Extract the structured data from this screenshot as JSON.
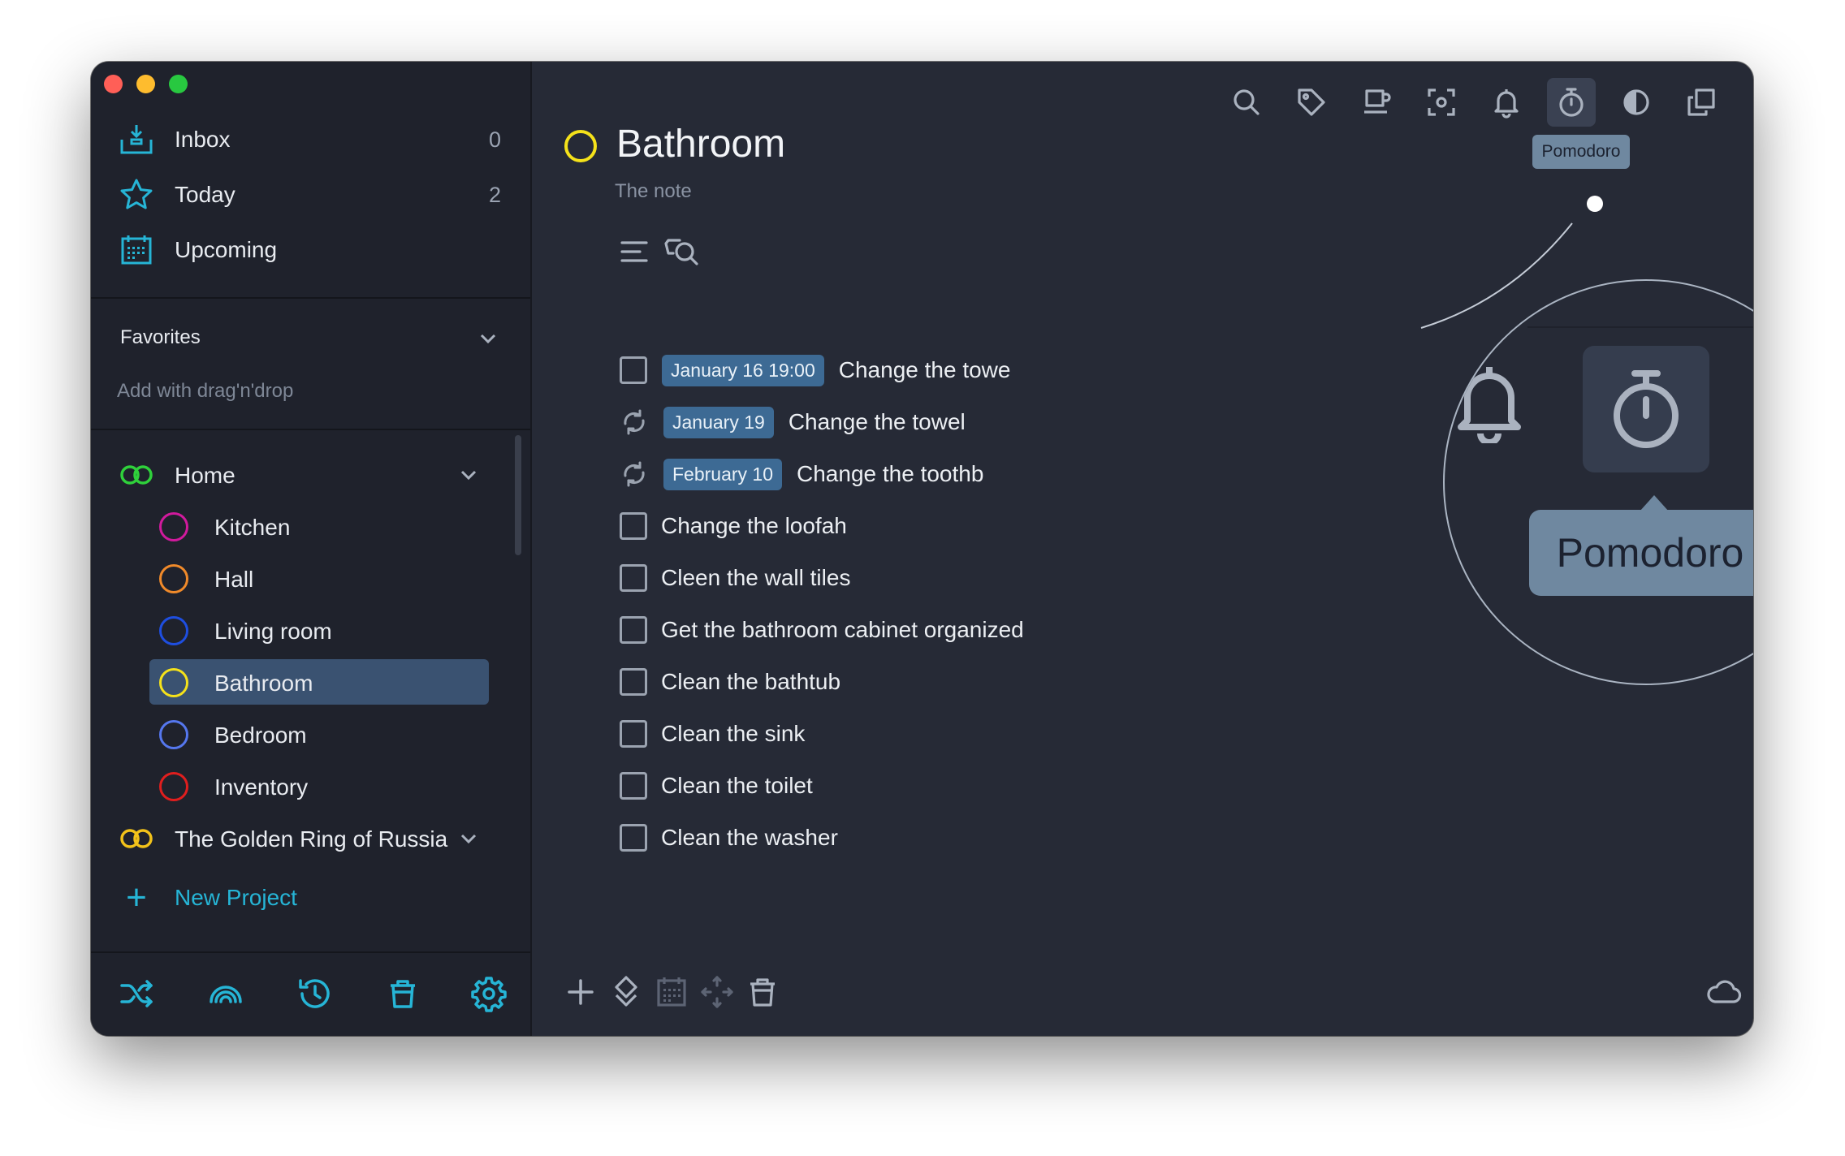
{
  "sidebar": {
    "nav": [
      {
        "label": "Inbox",
        "count": "0",
        "icon": "inbox-icon"
      },
      {
        "label": "Today",
        "count": "2",
        "icon": "star-icon"
      },
      {
        "label": "Upcoming",
        "count": "",
        "icon": "calendar-icon"
      }
    ],
    "favorites": {
      "title": "Favorites",
      "hint": "Add with drag'n'drop"
    },
    "groups": [
      {
        "label": "Home",
        "color": "#2fd13b"
      },
      {
        "label": "The Golden Ring of Russia",
        "color": "#f2c21a"
      }
    ],
    "projects": [
      {
        "label": "Kitchen",
        "color": "#d11a9d"
      },
      {
        "label": "Hall",
        "color": "#f08a2a"
      },
      {
        "label": "Living room",
        "color": "#1e4ee0"
      },
      {
        "label": "Bathroom",
        "color": "#f5e21a"
      },
      {
        "label": "Bedroom",
        "color": "#5577ee"
      },
      {
        "label": "Inventory",
        "color": "#e01e1e"
      }
    ],
    "new_project": "New Project"
  },
  "main": {
    "title": "Bathroom",
    "note": "The note",
    "tooltip": "Pomodoro",
    "magnifier_tooltip": "Pomodoro",
    "tasks": [
      {
        "type": "checkbox",
        "date": "January 16 19:00",
        "text": "Change the towe"
      },
      {
        "type": "repeat",
        "date": "January 19",
        "text": "Change the towel"
      },
      {
        "type": "repeat",
        "date": "February 10",
        "text": "Change the toothb"
      },
      {
        "type": "checkbox",
        "date": "",
        "text": "Change the loofah"
      },
      {
        "type": "checkbox",
        "date": "",
        "text": "Cleen the wall tiles"
      },
      {
        "type": "checkbox",
        "date": "",
        "text": "Get the bathroom cabinet organized"
      },
      {
        "type": "checkbox",
        "date": "",
        "text": "Clean the bathtub"
      },
      {
        "type": "checkbox",
        "date": "",
        "text": "Clean the sink"
      },
      {
        "type": "checkbox",
        "date": "",
        "text": "Clean the toilet"
      },
      {
        "type": "checkbox",
        "date": "",
        "text": "Clean the washer"
      }
    ]
  },
  "colors": {
    "accent": "#26b5d6",
    "selected": "#3a5271",
    "date_badge": "#3d6a94"
  }
}
